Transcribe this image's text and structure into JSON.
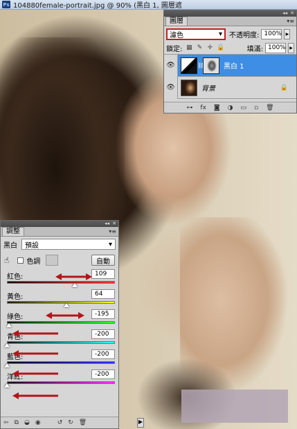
{
  "document": {
    "title": "104880female-portrait.jpg @ 90% (黑白 1, 圖層遮",
    "app_icon": "Ps"
  },
  "layers_panel": {
    "tab": "圖層",
    "blend_mode": "濾色",
    "opacity_label": "不透明度:",
    "opacity_value": "100%",
    "lock_label": "鎖定:",
    "fill_label": "填滿:",
    "fill_value": "100%",
    "layers": [
      {
        "name": "黑白 1",
        "selected": true
      },
      {
        "name": "背景",
        "selected": false
      }
    ],
    "footer_icons": [
      "link-icon",
      "fx-icon",
      "mask-icon",
      "adjustment-icon",
      "group-icon",
      "new-layer-icon",
      "trash-icon"
    ]
  },
  "adjust_panel": {
    "tab": "調整",
    "adjustment_type": "黑白",
    "preset": "預設",
    "tint_label": "色調",
    "auto_button": "自動",
    "sliders": [
      {
        "label": "紅色:",
        "value": "109",
        "gradient": "#1a0000,#ff3030",
        "knob_pos": 0.63
      },
      {
        "label": "黃色:",
        "value": "64",
        "gradient": "#1a1a00,#ffff30",
        "knob_pos": 0.55
      },
      {
        "label": "綠色:",
        "value": "-195",
        "gradient": "#001a00,#30ff30",
        "knob_pos": 0.02
      },
      {
        "label": "青色:",
        "value": "-200",
        "gradient": "#001a1a,#30ffff",
        "knob_pos": 0.0
      },
      {
        "label": "藍色:",
        "value": "-200",
        "gradient": "#00001a,#3030ff",
        "knob_pos": 0.0
      },
      {
        "label": "洋紅:",
        "value": "-200",
        "gradient": "#1a001a,#ff30ff",
        "knob_pos": 0.0
      }
    ]
  },
  "colors": {
    "highlight": "#3d8ee4",
    "annotation_red": "#c0201f",
    "arrow_red": "#b4151a"
  }
}
